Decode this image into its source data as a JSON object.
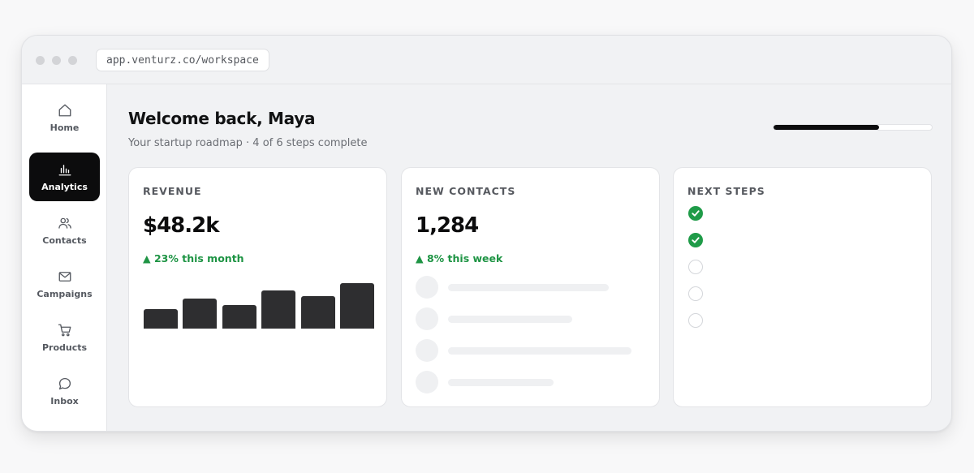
{
  "browser": {
    "url": "app.venturz.co/workspace"
  },
  "sidebar": {
    "items": [
      {
        "label": "Home",
        "icon": "home-icon",
        "active": false
      },
      {
        "label": "Analytics",
        "icon": "bar-chart-icon",
        "active": true
      },
      {
        "label": "Contacts",
        "icon": "users-icon",
        "active": false
      },
      {
        "label": "Campaigns",
        "icon": "mail-icon",
        "active": false
      },
      {
        "label": "Products",
        "icon": "cart-icon",
        "active": false
      },
      {
        "label": "Inbox",
        "icon": "chat-bubble-icon",
        "active": false
      }
    ]
  },
  "header": {
    "title": "Welcome back, Maya",
    "subtitle": "Your startup roadmap · 4 of 6 steps complete",
    "progress_fraction": 0.667
  },
  "revenue_card": {
    "title": "REVENUE",
    "value": "$48.2k",
    "delta": "▲ 23% this month",
    "bar_values": [
      0.42,
      0.66,
      0.52,
      0.84,
      0.72,
      1.0
    ]
  },
  "contacts_card": {
    "title": "NEW CONTACTS",
    "value": "1,284",
    "delta": "▲ 8% this week"
  },
  "steps_card": {
    "title": "NEXT STEPS",
    "steps": [
      {
        "done": true
      },
      {
        "done": true
      },
      {
        "done": false
      },
      {
        "done": false
      },
      {
        "done": false
      }
    ]
  },
  "colors": {
    "accent": "#0c0c0d",
    "positive": "#1e9444",
    "check": "#1f9b48",
    "background": "#f1f2f4"
  }
}
